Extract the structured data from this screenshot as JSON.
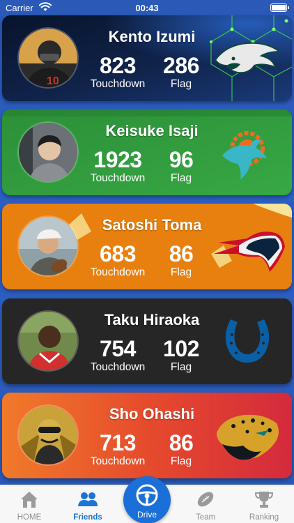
{
  "status_bar": {
    "carrier": "Carrier",
    "time": "00:43"
  },
  "players": [
    {
      "name": "Kento Izumi",
      "touchdown": "823",
      "flag": "286",
      "touchdown_label": "Touchdown",
      "flag_label": "Flag",
      "team_icon": "eagle-logo-icon",
      "card_color": "#0f1e3a"
    },
    {
      "name": "Keisuke Isaji",
      "touchdown": "1923",
      "flag": "96",
      "touchdown_label": "Touchdown",
      "flag_label": "Flag",
      "team_icon": "dolphin-logo-icon",
      "card_color": "#2e9a3a"
    },
    {
      "name": "Satoshi Toma",
      "touchdown": "683",
      "flag": "86",
      "touchdown_label": "Touchdown",
      "flag_label": "Flag",
      "team_icon": "patriot-logo-icon",
      "card_color": "#e87e12"
    },
    {
      "name": "Taku Hiraoka",
      "touchdown": "754",
      "flag": "102",
      "touchdown_label": "Touchdown",
      "flag_label": "Flag",
      "team_icon": "horseshoe-logo-icon",
      "card_color": "#262626"
    },
    {
      "name": "Sho Ohashi",
      "touchdown": "713",
      "flag": "86",
      "touchdown_label": "Touchdown",
      "flag_label": "Flag",
      "team_icon": "jaguar-logo-icon",
      "card_color": "#e24a2a"
    }
  ],
  "tabs": [
    {
      "label": "HOME",
      "icon": "home-icon",
      "active": false
    },
    {
      "label": "Friends",
      "icon": "friends-icon",
      "active": true
    },
    {
      "label": "Drive",
      "icon": "steering-wheel-icon",
      "active": false
    },
    {
      "label": "Team",
      "icon": "football-icon",
      "active": false
    },
    {
      "label": "Ranking",
      "icon": "trophy-icon",
      "active": false
    }
  ],
  "colors": {
    "background": "#2c5fc4",
    "tab_active": "#1a73d6",
    "tab_inactive": "#8e8e93",
    "drive_button": "#1a6fd8"
  }
}
